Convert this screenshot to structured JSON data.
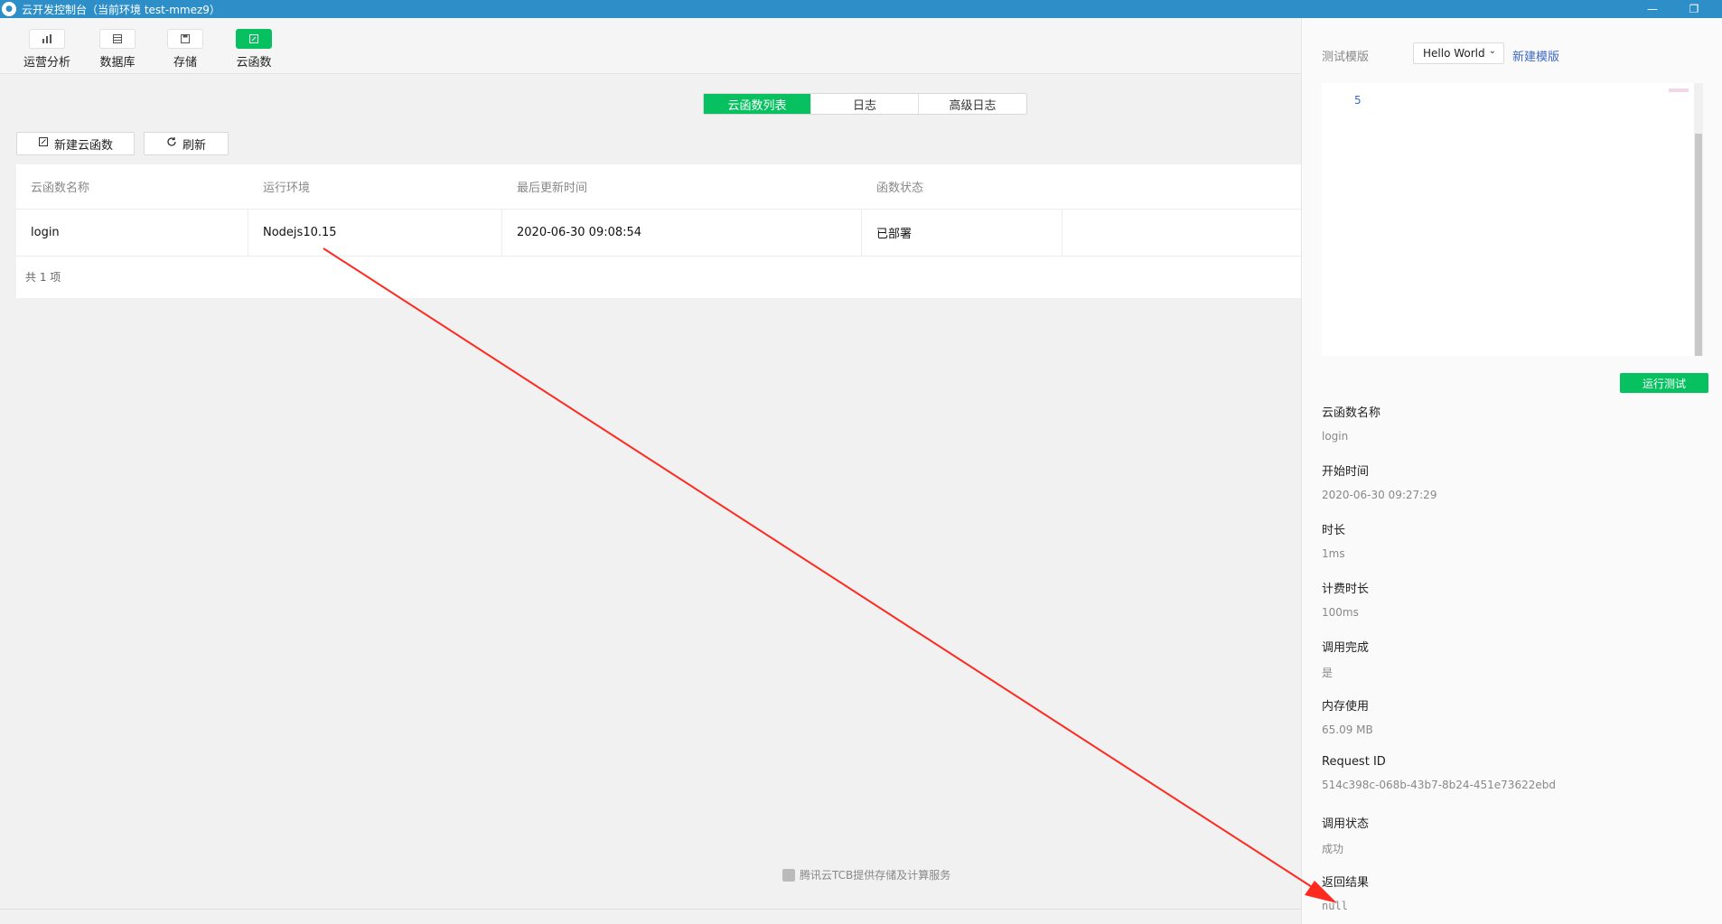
{
  "window": {
    "title": "云开发控制台（当前环境 test-mmez9）",
    "controls": {
      "minimize": "—",
      "restore": "❐"
    }
  },
  "toolbar": {
    "items": [
      {
        "label": "运营分析",
        "icon": "bar-chart-icon"
      },
      {
        "label": "数据库",
        "icon": "database-icon"
      },
      {
        "label": "存储",
        "icon": "storage-icon"
      },
      {
        "label": "云函数",
        "icon": "cloud-function-icon",
        "active": true
      }
    ]
  },
  "tabs": [
    {
      "label": "云函数列表",
      "active": true
    },
    {
      "label": "日志"
    },
    {
      "label": "高级日志"
    }
  ],
  "actions": {
    "new_label": "新建云函数",
    "refresh_label": "刷新"
  },
  "table": {
    "columns": [
      "云函数名称",
      "运行环境",
      "最后更新时间",
      "函数状态"
    ],
    "rows": [
      {
        "name": "login",
        "runtime": "Nodejs10.15",
        "updated": "2020-06-30 09:08:54",
        "status": "已部署"
      }
    ],
    "total": "共 1 项"
  },
  "footer": {
    "provider": "腾讯云TCB提供存储及计算服务"
  },
  "panel": {
    "template_label": "测试模版",
    "template_value": "Hello World",
    "new_template": "新建模版",
    "editor_line": "5",
    "run_button": "运行测试",
    "result": {
      "name": {
        "label": "云函数名称",
        "value": "login"
      },
      "start": {
        "label": "开始时间",
        "value": "2020-06-30 09:27:29"
      },
      "duration": {
        "label": "时长",
        "value": "1ms"
      },
      "billed": {
        "label": "计费时长",
        "value": "100ms"
      },
      "completed": {
        "label": "调用完成",
        "value": "是"
      },
      "memory": {
        "label": "内存使用",
        "value": "65.09 MB"
      },
      "request_id": {
        "label": "Request ID",
        "value": "514c398c-068b-43b7-8b24-451e73622ebd"
      },
      "status": {
        "label": "调用状态",
        "value": "成功"
      },
      "return": {
        "label": "返回结果",
        "value": "null"
      }
    }
  },
  "colors": {
    "accent": "#07c160",
    "titlebar": "#2e8fc8",
    "link": "#3d68c4",
    "annotation": "#ff2a1f"
  }
}
